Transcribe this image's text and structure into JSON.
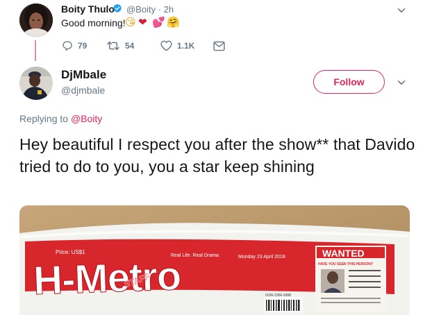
{
  "parent_tweet": {
    "author_name": "Boity Thulo",
    "author_handle": "@Boity · 2h",
    "text": "Good morning!",
    "emojis": [
      "😘",
      "❤",
      "💕",
      "🤗"
    ],
    "actions": {
      "replies": "79",
      "retweets": "54",
      "likes": "1.1K"
    },
    "colors": {
      "verified": "#1da1f2"
    }
  },
  "reply_tweet": {
    "author_name": "DjMbale",
    "author_handle": "@djmbale",
    "follow_label": "Follow",
    "replying_prefix": "Replying to ",
    "replying_mention": "@Boity",
    "text": "Hey beautiful I respect you after the show** that Davido tried to do to you, you a star keep shining",
    "colors": {
      "accent": "#e0245e"
    }
  },
  "media": {
    "masthead": "H-Metro",
    "tagline": "Real Life. Real Drama",
    "date": "Monday 23 April 2018",
    "price": "Price: US$1",
    "wanted_title": "WANTED",
    "wanted_subtitle": "HAVE YOU SEEN THIS PERSON?",
    "issn": "ISSN 2306-2088",
    "stamp": "STAFF"
  }
}
